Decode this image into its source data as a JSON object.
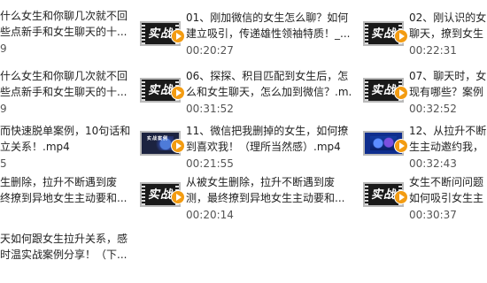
{
  "columns": [
    {
      "items": [
        {
          "line1": "什么女生和你聊几次就不回",
          "line2": "些点新手和女生聊天的十...",
          "duration": "9"
        },
        {
          "line1": "什么女生和你聊几次就不回",
          "line2": "些点新手和女生聊天的十...",
          "duration": "9"
        },
        {
          "line1": "而快速脱单案例，10句话和",
          "line2": "立关系！.mp4",
          "duration": "5"
        },
        {
          "line1": "生删除，拉升不断遇到废",
          "line2": "终撩到异地女生主动要和...",
          "duration": ""
        },
        {
          "line1": "天如何跟女生拉升关系，感",
          "line2": "时温实战案例分享！（下...",
          "duration": ""
        }
      ]
    },
    {
      "items": [
        {
          "line1": "01、刚加微信的女生怎么聊？如何",
          "line2": "建立吸引，传递雄性领袖特质！_...",
          "duration": "00:20:27",
          "thumb": "fire"
        },
        {
          "line1": "06、探探、积目匹配到女生后，怎",
          "line2": "么和女生聊天，怎么加到微信？.m...",
          "duration": "00:31:52",
          "thumb": "fire"
        },
        {
          "line1": "11、微信把我删掉的女生，如何撩",
          "line2": "到喜欢我！（理所当然感）.mp4",
          "duration": "00:21:55",
          "thumb": "dark"
        },
        {
          "line1": "从被女生删除，拉升不断遇到废",
          "line2": "测，最终撩到异地女生主动要和...",
          "duration": "00:20:14",
          "thumb": "fire"
        }
      ]
    },
    {
      "items": [
        {
          "line1": "02、刚认识的女",
          "line2": "聊天，撩到女生",
          "duration": "00:22:31",
          "thumb": "fire"
        },
        {
          "line1": "07、聊天时，女",
          "line2": "现有哪些？案例",
          "duration": "00:32:52",
          "thumb": "fire"
        },
        {
          "line1": "12、从拉升不断",
          "line2": "生主动邀约我，",
          "duration": "00:32:43",
          "thumb": "blue"
        },
        {
          "line1": "女生不断问问题",
          "line2": "如何吸引女生主",
          "duration": "00:30:37",
          "thumb": "fire"
        }
      ]
    }
  ],
  "thumb_text": {
    "fire": "实战",
    "dark": "实战案例"
  }
}
